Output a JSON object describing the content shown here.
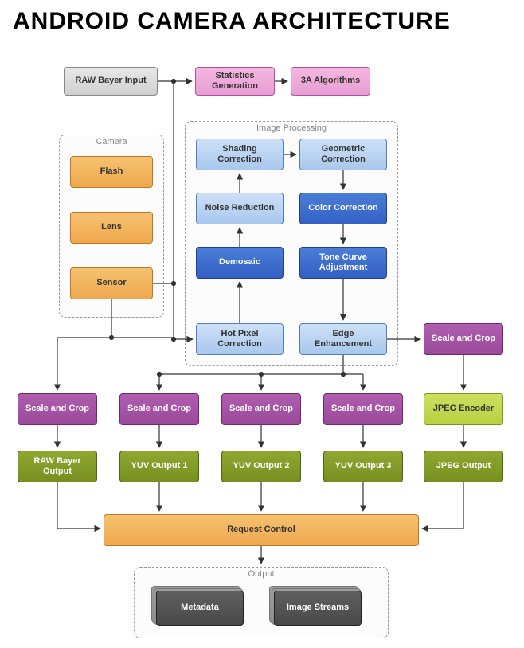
{
  "title": "ANDROID CAMERA ARCHITECTURE",
  "top": {
    "raw_input": "RAW Bayer Input",
    "stats_gen": "Statistics Generation",
    "algos": "3A Algorithms"
  },
  "camera": {
    "group": "Camera",
    "flash": "Flash",
    "lens": "Lens",
    "sensor": "Sensor"
  },
  "ip": {
    "group": "Image Processing",
    "shading": "Shading Correction",
    "geometric": "Geometric Correction",
    "noise": "Noise Reduction",
    "color": "Color Correction",
    "demosaic": "Demosaic",
    "tone": "Tone Curve Adjustment",
    "hotpixel": "Hot Pixel Correction",
    "edge": "Edge Enhancement"
  },
  "scale_crop": "Scale and Crop",
  "jpeg_encoder": "JPEG Encoder",
  "outputs": {
    "raw": "RAW Bayer Output",
    "yuv1": "YUV Output 1",
    "yuv2": "YUV Output 2",
    "yuv3": "YUV Output 3",
    "jpeg": "JPEG Output"
  },
  "request_control": "Request Control",
  "output_group": {
    "label": "Output",
    "metadata": "Metadata",
    "streams": "Image Streams"
  }
}
